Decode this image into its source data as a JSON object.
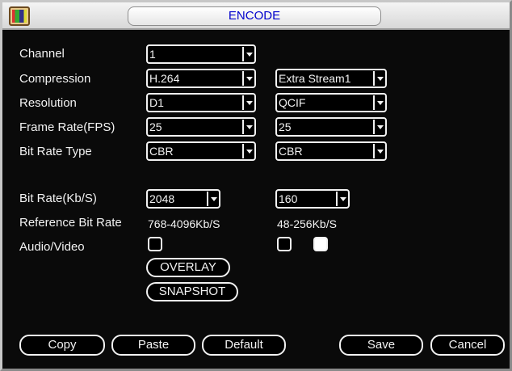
{
  "window": {
    "title": "ENCODE"
  },
  "form": {
    "channel_label": "Channel",
    "compression_label": "Compression",
    "resolution_label": "Resolution",
    "frame_rate_label": "Frame Rate(FPS)",
    "bit_rate_type_label": "Bit Rate Type",
    "bit_rate_label": "Bit Rate(Kb/S)",
    "reference_bit_rate_label": "Reference Bit Rate",
    "audio_video_label": "Audio/Video",
    "channel": "1",
    "main": {
      "compression": "H.264",
      "resolution": "D1",
      "frame_rate": "25",
      "bit_rate_type": "CBR",
      "bit_rate": "2048",
      "reference_bit_rate": "768-4096Kb/S",
      "audio_video_checked": false
    },
    "extra": {
      "stream": "Extra Stream1",
      "resolution": "QCIF",
      "frame_rate": "25",
      "bit_rate_type": "CBR",
      "bit_rate": "160",
      "reference_bit_rate": "48-256Kb/S",
      "audio_video_checked": false,
      "extra_checkbox_checked": true
    },
    "overlay_label": "OVERLAY",
    "snapshot_label": "SNAPSHOT"
  },
  "buttons": {
    "copy": "Copy",
    "paste": "Paste",
    "default": "Default",
    "save": "Save",
    "cancel": "Cancel"
  }
}
